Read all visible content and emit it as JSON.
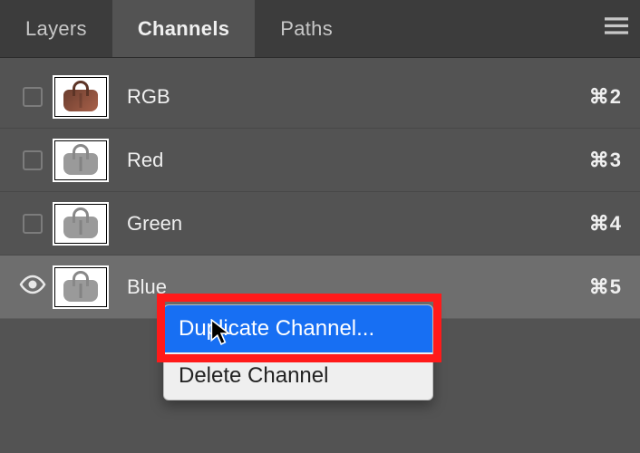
{
  "tabs": {
    "layers": "Layers",
    "channels": "Channels",
    "paths": "Paths",
    "active": "channels"
  },
  "channels": [
    {
      "name": "RGB",
      "shortcut": "⌘2",
      "visible": false,
      "thumb": "rgb",
      "selected": false
    },
    {
      "name": "Red",
      "shortcut": "⌘3",
      "visible": false,
      "thumb": "gray",
      "selected": false
    },
    {
      "name": "Green",
      "shortcut": "⌘4",
      "visible": false,
      "thumb": "gray",
      "selected": false
    },
    {
      "name": "Blue",
      "shortcut": "⌘5",
      "visible": true,
      "thumb": "gray",
      "selected": true
    }
  ],
  "context_menu": {
    "items": [
      {
        "label": "Duplicate Channel...",
        "highlight": true
      },
      {
        "label": "Delete Channel",
        "highlight": false
      }
    ]
  }
}
